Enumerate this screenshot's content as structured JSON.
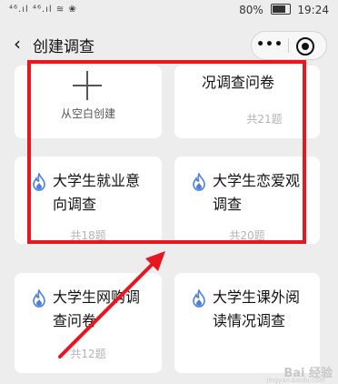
{
  "status_bar": {
    "signal": "⁴⁶.ıl ⁴⁶.ıl ≋ ❀",
    "battery": "80%",
    "time": "19:24"
  },
  "header": {
    "title": "创建调查",
    "back_icon": "chevron-left-icon",
    "more_icon": "ellipsis-icon",
    "record_icon": "target-icon"
  },
  "blank_card": {
    "label": "从空白创建"
  },
  "templates": [
    {
      "line1": "况调查问卷",
      "count": "共21题"
    },
    {
      "line1": "大学生就业意",
      "line2": "向调查",
      "count": "共18题"
    },
    {
      "line1": "大学生恋爱观",
      "line2": "调查",
      "count": "共20题"
    },
    {
      "line1": "大学生网购调",
      "line2": "查问卷",
      "count": "共12题"
    },
    {
      "line1": "大学生课外阅",
      "line2": "读情况调查",
      "count": ""
    }
  ],
  "watermark": {
    "text": "Bai 经验",
    "sub": "jingyan.baidu.com"
  },
  "colors": {
    "highlight": "#e8161f",
    "fire": "#4a7fe0",
    "background": "#ededed"
  }
}
